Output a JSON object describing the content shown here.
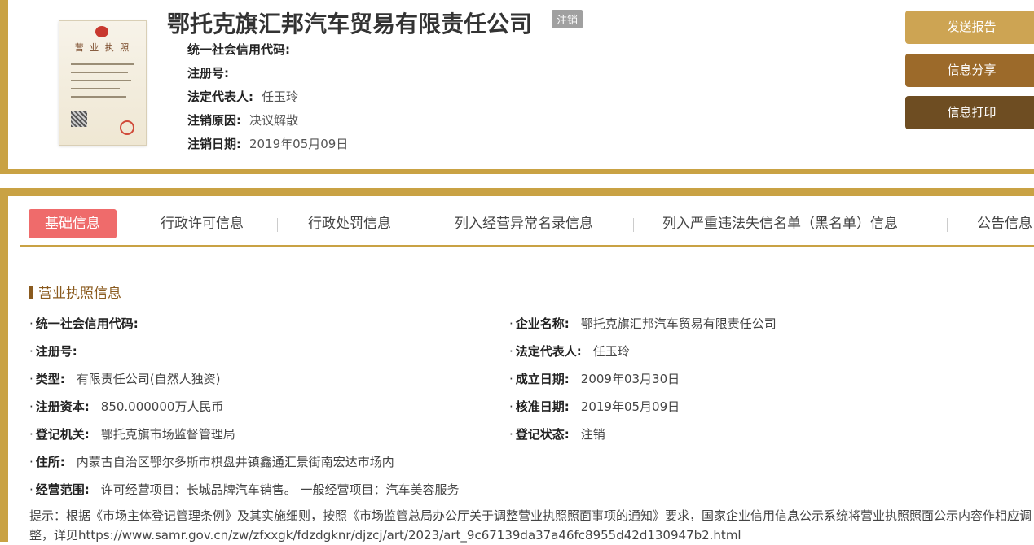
{
  "header": {
    "company_name": "鄂托克旗汇邦汽车贸易有限责任公司",
    "status_tag": "注销",
    "license_thumb_title": "营 业 执 照",
    "rows": [
      {
        "label": "统一社会信用代码:",
        "value": ""
      },
      {
        "label": "注册号:",
        "value": ""
      },
      {
        "label": "法定代表人:",
        "value": "任玉玲"
      },
      {
        "label": "注销原因:",
        "value": "决议解散"
      },
      {
        "label": "注销日期:",
        "value": "2019年05月09日"
      }
    ],
    "buttons": {
      "send": "发送报告",
      "share": "信息分享",
      "print": "信息打印"
    }
  },
  "tabs": [
    {
      "label": "基础信息",
      "active": true
    },
    {
      "label": "行政许可信息"
    },
    {
      "label": "行政处罚信息"
    },
    {
      "label": "列入经营异常名录信息"
    },
    {
      "label": "列入严重违法失信名单（黑名单）信息"
    },
    {
      "label": "公告信息"
    }
  ],
  "section_title": "营业执照信息",
  "info": {
    "credit_code": {
      "label": "统一社会信用代码:",
      "value": ""
    },
    "company_name": {
      "label": "企业名称:",
      "value": "鄂托克旗汇邦汽车贸易有限责任公司"
    },
    "reg_no": {
      "label": "注册号:",
      "value": ""
    },
    "legal_rep": {
      "label": "法定代表人:",
      "value": "任玉玲"
    },
    "type": {
      "label": "类型:",
      "value": "有限责任公司(自然人独资)"
    },
    "established": {
      "label": "成立日期:",
      "value": "2009年03月30日"
    },
    "capital": {
      "label": "注册资本:",
      "value": "850.000000万人民币"
    },
    "approved": {
      "label": "核准日期:",
      "value": "2019年05月09日"
    },
    "authority": {
      "label": "登记机关:",
      "value": "鄂托克旗市场监督管理局"
    },
    "reg_status": {
      "label": "登记状态:",
      "value": "注销"
    },
    "address": {
      "label": "住所:",
      "value": "内蒙古自治区鄂尔多斯市棋盘井镇鑫通汇景街南宏达市场内"
    },
    "scope": {
      "label": "经营范围:",
      "value": "许可经营项目：长城品牌汽车销售。 一般经营项目：汽车美容服务"
    }
  },
  "notice": "提示：根据《市场主体登记管理条例》及其实施细则，按照《市场监管总局办公厅关于调整营业执照照面事项的通知》要求，国家企业信用信息公示系统将营业执照照面公示内容作相应调整，详见https://www.samr.gov.cn/zw/zfxxgk/fdzdgknr/djzcj/art/2023/art_9c67139da37a46fc8955d42d130947b2.html",
  "colors": {
    "gold": "#c9a244",
    "active_tab": "#ef6b6b",
    "btn_send": "#cda453",
    "btn_share": "#9c6a2a",
    "btn_print": "#6e4d22"
  }
}
